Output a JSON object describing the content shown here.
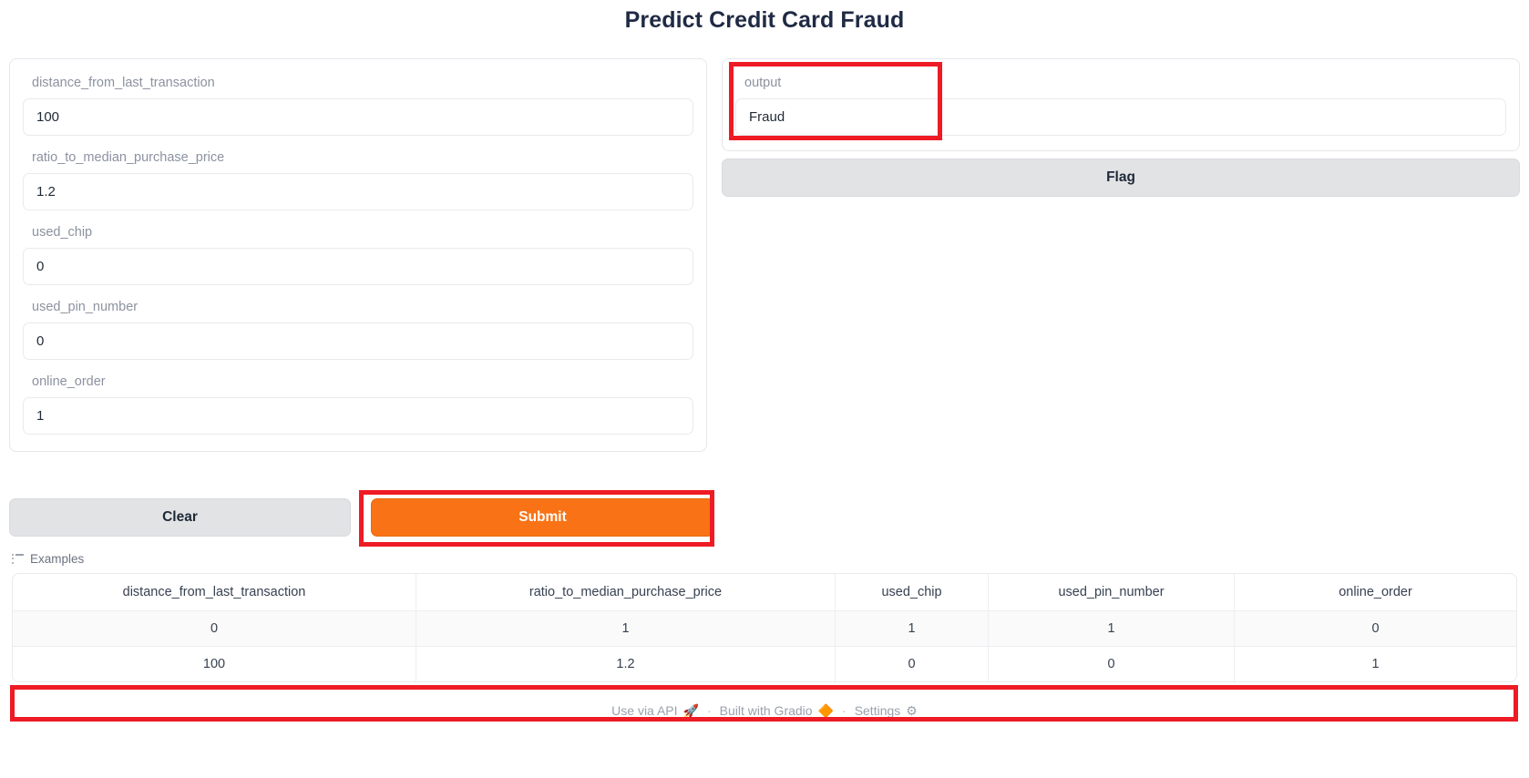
{
  "header": {
    "title": "Predict Credit Card Fraud"
  },
  "inputs": {
    "fields": [
      {
        "label": "distance_from_last_transaction",
        "value": "100"
      },
      {
        "label": "ratio_to_median_purchase_price",
        "value": "1.2"
      },
      {
        "label": "used_chip",
        "value": "0"
      },
      {
        "label": "used_pin_number",
        "value": "0"
      },
      {
        "label": "online_order",
        "value": "1"
      }
    ]
  },
  "output": {
    "label": "output",
    "value": "Fraud"
  },
  "actions": {
    "flag_label": "Flag",
    "clear_label": "Clear",
    "submit_label": "Submit"
  },
  "examples": {
    "heading": "Examples",
    "columns": [
      "distance_from_last_transaction",
      "ratio_to_median_purchase_price",
      "used_chip",
      "used_pin_number",
      "online_order"
    ],
    "rows": [
      {
        "c0": "0",
        "c1": "1",
        "c2": "1",
        "c3": "1",
        "c4": "0"
      },
      {
        "c0": "100",
        "c1": "1.2",
        "c2": "0",
        "c3": "0",
        "c4": "1"
      }
    ]
  },
  "footer": {
    "api_label": "Use via API",
    "api_icon": "rocket-icon",
    "api_glyph": "🚀",
    "sep1": "·",
    "gradio_label": "Built with Gradio",
    "gradio_icon": "gradio-logo-icon",
    "gradio_glyph": "🔶",
    "sep2": "·",
    "settings_label": "Settings",
    "settings_icon": "gear-icon",
    "settings_glyph": "⚙"
  },
  "colors": {
    "accent_orange": "#f97316",
    "annotation_red": "#ee1b24",
    "title_navy": "#1f2a44",
    "label_grey": "#8b92a0",
    "button_grey": "#e2e3e5"
  }
}
